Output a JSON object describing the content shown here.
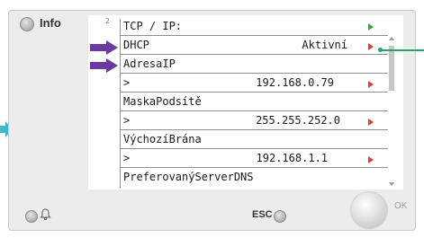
{
  "panel": {
    "info_label": "Info",
    "esc_label": "ESC",
    "ok_label": "OK"
  },
  "screen": {
    "page_number": "2",
    "header": "TCP / IP:",
    "rows": [
      {
        "name": "DHCP",
        "value": "Aktivní"
      },
      {
        "name": "AdresaIP",
        "value": ""
      },
      {
        "name": ">",
        "value": "192.168.0.79"
      },
      {
        "name": "MaskaPodsítě",
        "value": ""
      },
      {
        "name": ">",
        "value": "255.255.252.0"
      },
      {
        "name": "VýchozíBrána",
        "value": ""
      },
      {
        "name": ">",
        "value": "192.168.1.1"
      },
      {
        "name": "PreferovanýServerDNS",
        "value": ""
      }
    ]
  },
  "colors": {
    "highlight_arrows": "#6a3aa0",
    "callout": "#25a46a",
    "edit_marker": "#e23a3a",
    "header_marker": "#3aa63a",
    "left_arrow": "#3cb8c8"
  },
  "icons": [
    "bell-icon",
    "red-triangle-icon",
    "green-triangle-icon",
    "purple-arrow-icon"
  ]
}
